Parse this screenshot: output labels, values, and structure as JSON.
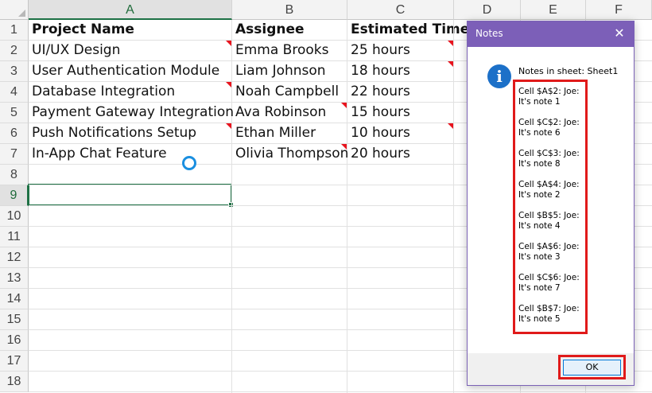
{
  "columns": [
    "A",
    "B",
    "C",
    "D",
    "E",
    "F"
  ],
  "rows": [
    "1",
    "2",
    "3",
    "4",
    "5",
    "6",
    "7",
    "8",
    "9",
    "10",
    "11",
    "12",
    "13",
    "14",
    "15",
    "16",
    "17",
    "18"
  ],
  "table": {
    "headers": [
      "Project Name",
      "Assignee",
      "Estimated Time"
    ],
    "data": [
      [
        "UI/UX Design",
        "Emma Brooks",
        "25 hours"
      ],
      [
        "User Authentication Module",
        "Liam Johnson",
        "18 hours"
      ],
      [
        "Database Integration",
        "Noah Campbell",
        "22 hours"
      ],
      [
        "Payment Gateway Integration",
        "Ava Robinson",
        "15 hours"
      ],
      [
        "Push Notifications Setup",
        "Ethan Miller",
        "10 hours"
      ],
      [
        "In-App Chat Feature",
        "Olivia Thompson",
        "20 hours"
      ]
    ]
  },
  "dialog": {
    "title": "Notes",
    "close": "✕",
    "info_glyph": "i",
    "heading": "Notes in sheet: Sheet1",
    "notes": [
      {
        "line1": "Cell $A$2: Joe:",
        "line2": "It's note 1"
      },
      {
        "line1": "Cell $C$2: Joe:",
        "line2": "It's note 6"
      },
      {
        "line1": "Cell $C$3: Joe:",
        "line2": "It's note 8"
      },
      {
        "line1": "Cell $A$4: Joe:",
        "line2": "It's note 2"
      },
      {
        "line1": "Cell $B$5: Joe:",
        "line2": "It's note 4"
      },
      {
        "line1": "Cell $A$6: Joe:",
        "line2": "It's note 3"
      },
      {
        "line1": "Cell $C$6: Joe:",
        "line2": "It's note 7"
      },
      {
        "line1": "Cell $B$7: Joe:",
        "line2": "It's note 5"
      }
    ],
    "ok_label": "OK"
  },
  "colors": {
    "accent_title_bar": "#7c5fb8",
    "highlight": "#e01a1a",
    "selection": "#1e7145",
    "note_indicator": "#e8141e"
  }
}
